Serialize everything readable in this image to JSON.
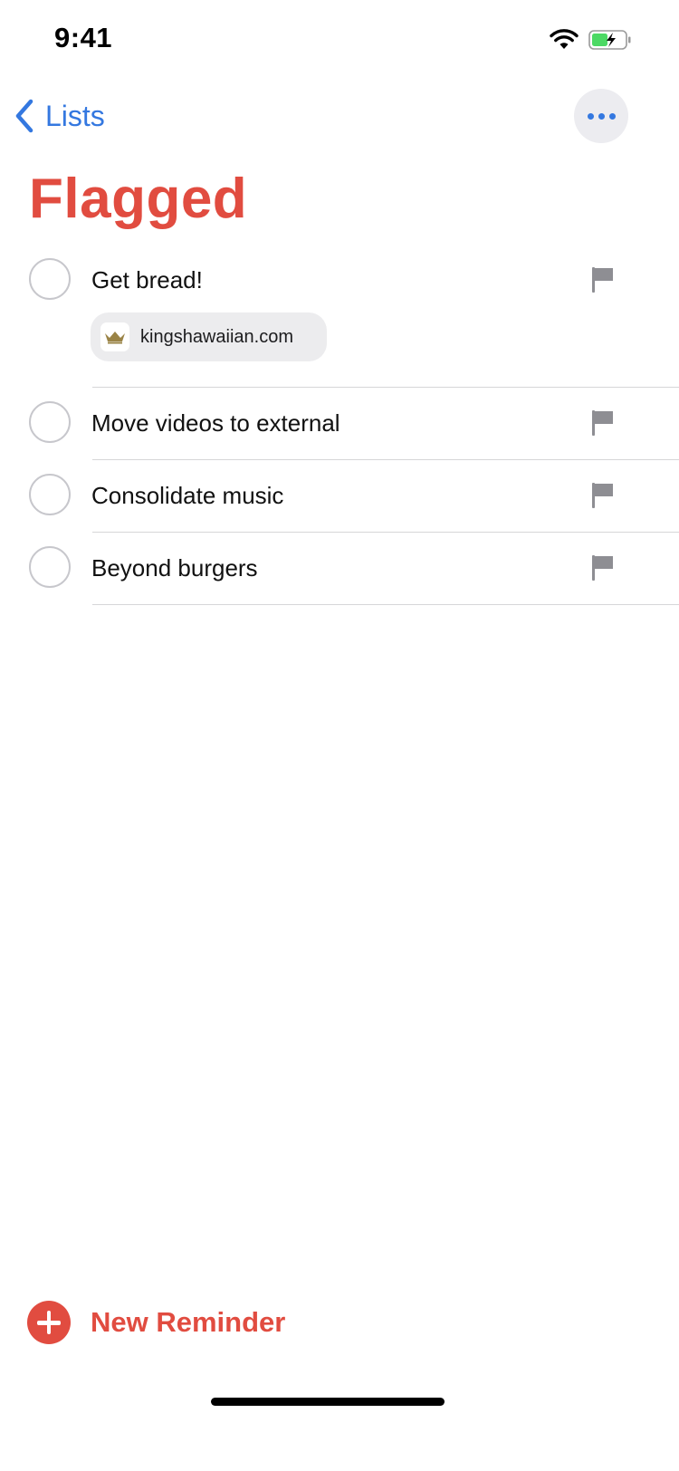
{
  "status_bar": {
    "time": "9:41"
  },
  "nav": {
    "back_label": "Lists"
  },
  "page": {
    "title": "Flagged"
  },
  "reminders": [
    {
      "title": "Get bread!",
      "flagged": true,
      "link": "kingshawaiian.com"
    },
    {
      "title": "Move videos to external",
      "flagged": true
    },
    {
      "title": "Consolidate music",
      "flagged": true
    },
    {
      "title": "Beyond burgers",
      "flagged": true
    }
  ],
  "footer": {
    "new_reminder_label": "New Reminder"
  },
  "colors": {
    "accent_red": "#e14c40",
    "ios_blue": "#3478e0",
    "flag_gray": "#8e8e93",
    "battery_green": "#4cd964"
  },
  "icons": {
    "back": "chevron-left-icon",
    "more": "ellipsis-icon",
    "flag": "flag-icon",
    "favicon": "crown-icon",
    "add": "plus-circle-icon"
  }
}
